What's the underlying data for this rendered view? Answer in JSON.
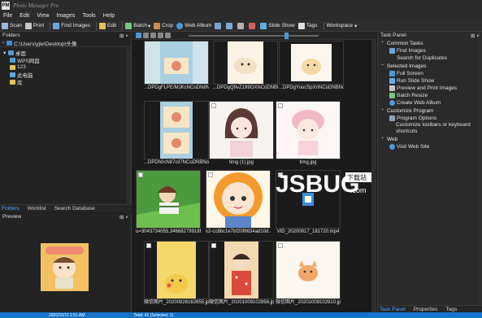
{
  "app": {
    "title": "Photo Manager Pro",
    "icon_label": "PM"
  },
  "menu": [
    "File",
    "Edit",
    "View",
    "Images",
    "Tools",
    "Help"
  ],
  "toolbar": {
    "scan": "Scan",
    "print": "Print",
    "find_images": "Find Images",
    "edit": "Edit",
    "batch": "Batch",
    "crop": "Crop",
    "web_album": "Web Album",
    "slide_show": "Slide Show",
    "tags": "Tags",
    "workspace": "Workspace"
  },
  "left_panel": {
    "title": "Folders",
    "path": "C:\\Users\\yjie\\Desktop\\头像",
    "tree": [
      "桌面",
      "WPS网盘",
      "123",
      "此电脑",
      "库"
    ],
    "tabs": [
      "Folders",
      "Worklist",
      "Search Database"
    ],
    "preview_title": "Preview"
  },
  "thumbnails": [
    {
      "caption": "...DPDgFLPE/MJKcNCoDN8No_1..."
    },
    {
      "caption": "...DPDgQ9vZ199OXNCoDNBNo_1..."
    },
    {
      "caption": "...DPDgYuucSpXnNCoDNBNo_1..."
    },
    {
      "caption": "...DPDh0cN87ciI7NCoDNBNo_1..."
    },
    {
      "caption": "timg (1).jpg"
    },
    {
      "caption": "timg.jpg"
    },
    {
      "caption": "u=3043734055,34668279918f..."
    },
    {
      "caption": "v2-cc8bc1e7bf20f8634ad10d..."
    },
    {
      "caption": "VID_20200817_181720.mp4"
    },
    {
      "caption": "微信图片_20200826162655.jpg"
    },
    {
      "caption": "微信图片_20201009102856.jpg"
    },
    {
      "caption": "微信图片_20201009102910.jpg"
    }
  ],
  "right_panel": {
    "title": "Task Panel",
    "sections": [
      {
        "title": "Common Tasks",
        "items": [
          "Find Images",
          "Search for Duplicates"
        ]
      },
      {
        "title": "Selected Images",
        "items": [
          "Full Screen",
          "Run Slide Show",
          "Preview and Print Images",
          "Batch Resize",
          "Create Web Album"
        ]
      },
      {
        "title": "Customize Program",
        "items": [
          "Program Options",
          "Customize toolbars or keyboard shortcuts"
        ]
      },
      {
        "title": "Web",
        "items": [
          "Visit Web Site"
        ]
      }
    ],
    "tabs": [
      "Task Panel",
      "Properties",
      "Tags"
    ]
  },
  "watermark": {
    "text": "JSBUG",
    "dotcom": ".com",
    "badge": "下载站"
  },
  "status": {
    "left": "2020/10/11 1:51 AM",
    "center": "Total: 41 (Selected: 1)"
  }
}
